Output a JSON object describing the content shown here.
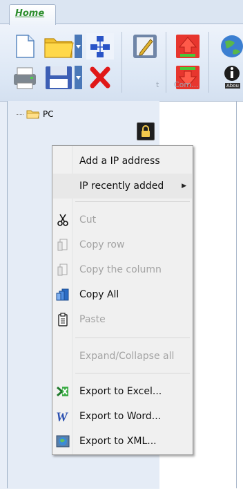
{
  "ribbon": {
    "tab_home": "Home",
    "group_label_partial": "t",
    "group_label_com": "Com...",
    "about_label": "Abou"
  },
  "tree": {
    "root_label": "PC"
  },
  "context_menu": {
    "items": [
      {
        "label": "Add a IP address",
        "enabled": true,
        "icon": null
      },
      {
        "label": "IP recently added",
        "enabled": true,
        "icon": null,
        "submenu": true,
        "submenu_arrow": "▶"
      },
      {
        "label": "Cut",
        "enabled": false,
        "icon": "scissors-icon"
      },
      {
        "label": "Copy row",
        "enabled": false,
        "icon": "copy-icon"
      },
      {
        "label": "Copy the column",
        "enabled": false,
        "icon": "copy-icon"
      },
      {
        "label": "Copy All",
        "enabled": true,
        "icon": "copy-all-icon"
      },
      {
        "label": "Paste",
        "enabled": false,
        "icon": "paste-icon"
      },
      {
        "label": "Expand/Collapse all",
        "enabled": false,
        "icon": null
      },
      {
        "label": "Export to Excel...",
        "enabled": true,
        "icon": "excel-icon"
      },
      {
        "label": "Export to Word...",
        "enabled": true,
        "icon": "word-icon"
      },
      {
        "label": "Export to XML...",
        "enabled": true,
        "icon": "xml-globe-icon"
      }
    ]
  },
  "colors": {
    "home_tab_text": "#2f8f2f",
    "menu_background": "#f0f0f0",
    "disabled_text": "#a3a3a3"
  }
}
